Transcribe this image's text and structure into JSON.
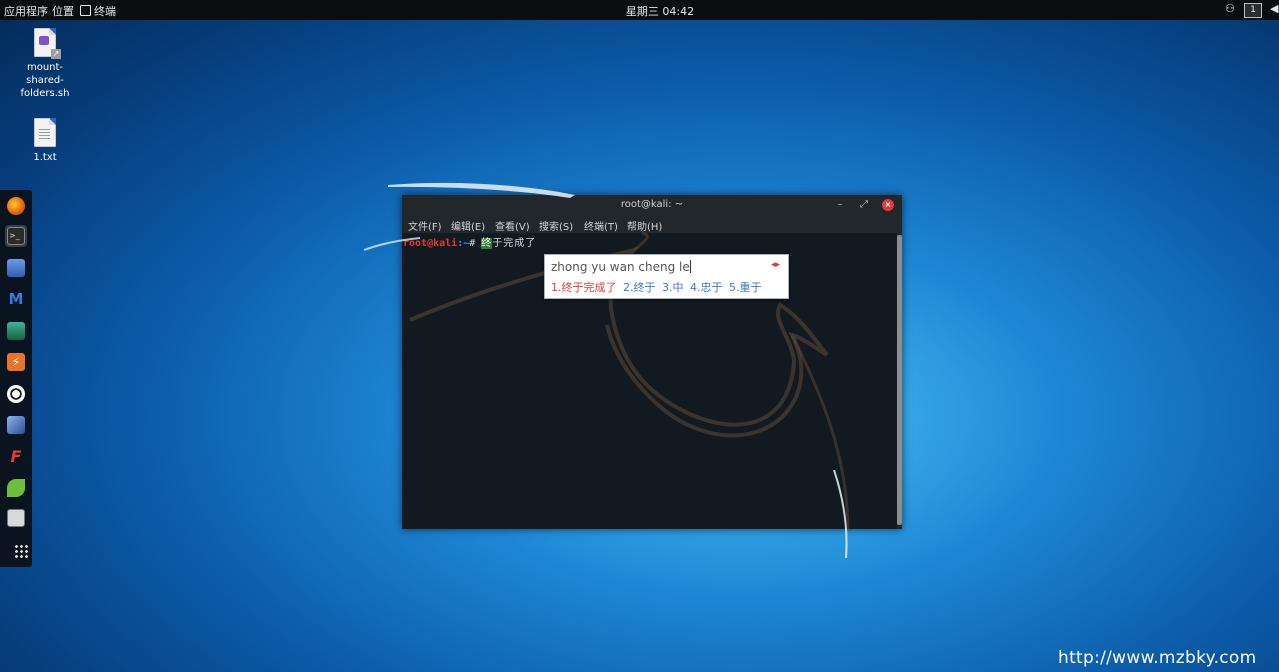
{
  "top_panel": {
    "applications": "应用程序",
    "places": "位置",
    "terminal": "终端",
    "clock": "星期三 04:42",
    "workspace": "1"
  },
  "desktop_icons": [
    {
      "label": "mount-\nshared-\nfolders.sh",
      "line1": "mount-",
      "line2": "shared-",
      "line3": "folders.sh",
      "icon": "script-file-icon"
    },
    {
      "label": "1.txt",
      "icon": "text-file-icon"
    }
  ],
  "dock": {
    "items": [
      {
        "name": "firefox",
        "icon": "firefox-icon",
        "color": "#e66000"
      },
      {
        "name": "terminal",
        "icon": "terminal-icon",
        "color": "#2b2b2b",
        "active": true
      },
      {
        "name": "files",
        "icon": "notes-icon",
        "color": "#3a6fc4"
      },
      {
        "name": "metasploit",
        "icon": "metasploit-icon",
        "color": "#1e66c8"
      },
      {
        "name": "armitage",
        "icon": "armitage-icon",
        "color": "#2e8b57"
      },
      {
        "name": "burpsuite",
        "icon": "burpsuite-icon",
        "color": "#e8742a"
      },
      {
        "name": "maltego",
        "icon": "maltego-icon",
        "color": "#ffffff"
      },
      {
        "name": "beef",
        "icon": "beef-icon",
        "color": "#4a6fb5"
      },
      {
        "name": "faraday",
        "icon": "faraday-icon",
        "color": "#d32f2f"
      },
      {
        "name": "leafpad",
        "icon": "leaf-icon",
        "color": "#6bbf3a"
      },
      {
        "name": "cherrytree",
        "icon": "cherrytree-icon",
        "color": "#d9d9d9"
      }
    ]
  },
  "terminal": {
    "title": "root@kali: ~",
    "menu": [
      "文件(F)",
      "编辑(E)",
      "查看(V)",
      "搜索(S)",
      "终端(T)",
      "帮助(H)"
    ],
    "prompt_user": "root@kali",
    "prompt_path": ":~",
    "prompt_symbol": "#",
    "input_highlight": "终",
    "input_rest": "于完成了"
  },
  "ime": {
    "preedit": "zhong yu wan cheng le",
    "arrows": "◂▸",
    "candidates": [
      {
        "index": "1.",
        "text": "终于完成了"
      },
      {
        "index": "2.",
        "text": "终于"
      },
      {
        "index": "3.",
        "text": "中"
      },
      {
        "index": "4.",
        "text": "忠于"
      },
      {
        "index": "5.",
        "text": "重于"
      }
    ]
  },
  "watermark": "http://www.mzbky.com",
  "colors": {
    "prompt_user": "#e53935",
    "prompt_path": "#4c8bf5",
    "first_candidate": "#e53935",
    "candidate": "#3f78c8"
  }
}
